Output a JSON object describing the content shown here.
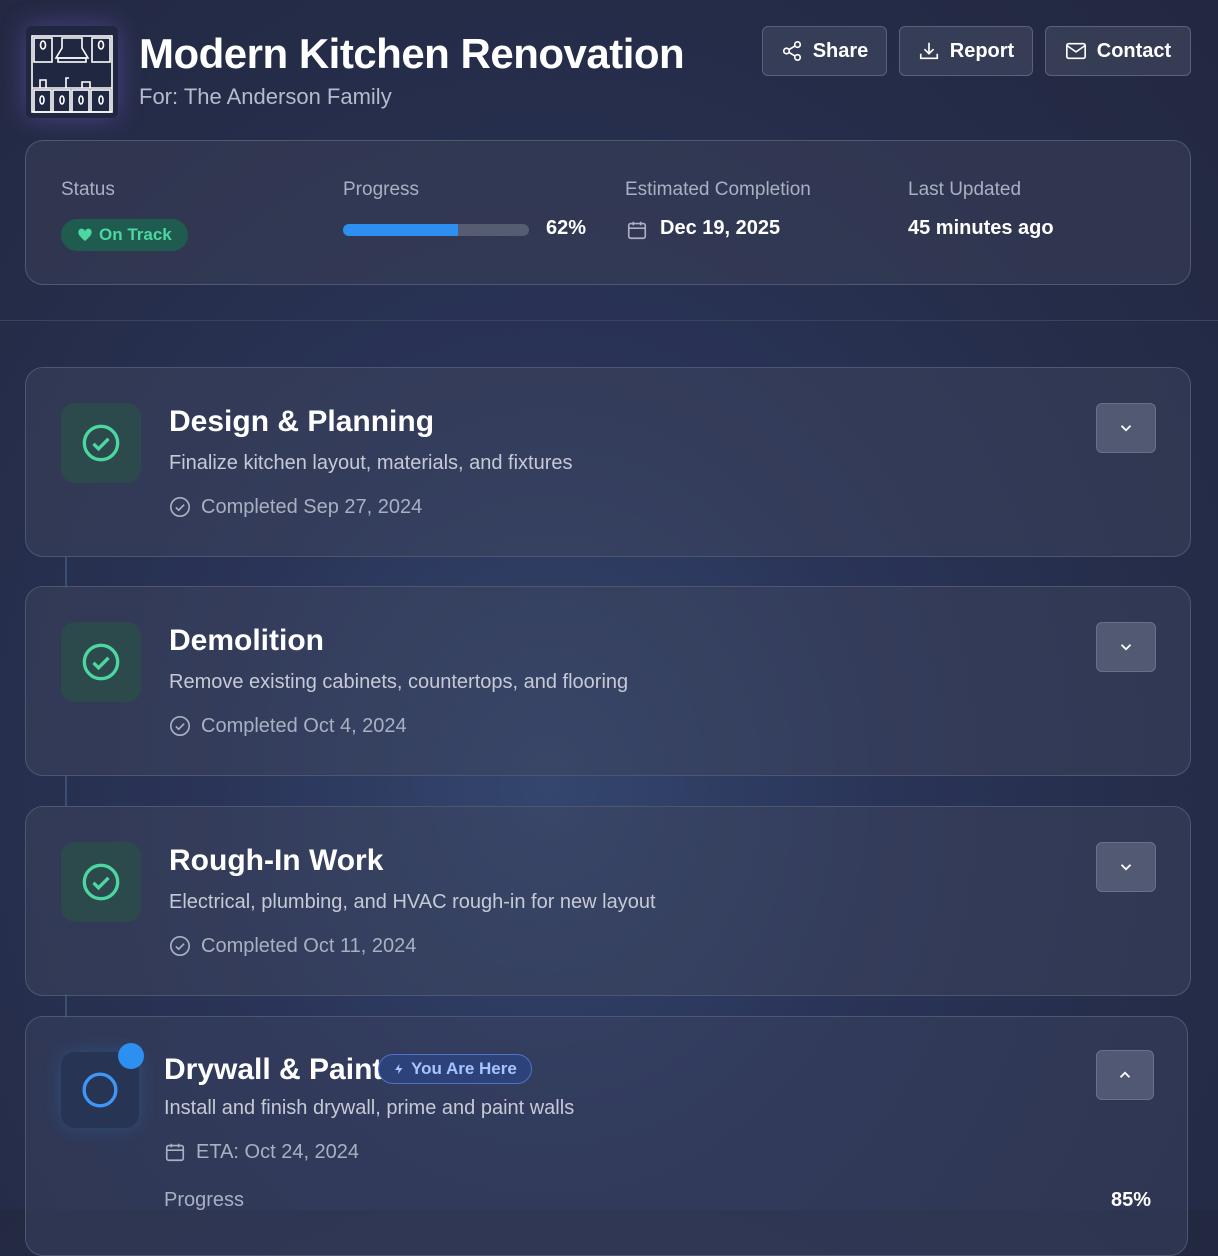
{
  "header": {
    "title": "Modern Kitchen Renovation",
    "subtitle": "For: The Anderson Family",
    "logo_icon": "kitchen-cabinets-icon",
    "buttons": [
      {
        "label": "Share",
        "icon": "share-icon"
      },
      {
        "label": "Report",
        "icon": "download-icon"
      },
      {
        "label": "Contact",
        "icon": "mail-icon"
      }
    ]
  },
  "summary": {
    "status_label": "Status",
    "status_value": "On Track",
    "status_color": "#4cd6a2",
    "progress_label": "Progress",
    "progress_percent": 62,
    "progress_text": "62%",
    "completion_label": "Estimated Completion",
    "completion_value": "Dec 19, 2025",
    "updated_label": "Last Updated",
    "updated_value": "45 minutes ago"
  },
  "phases": [
    {
      "title": "Design & Planning",
      "description": "Finalize kitchen layout, materials, and fixtures",
      "date_text": "Completed Sep 27, 2024",
      "state": "completed"
    },
    {
      "title": "Demolition",
      "description": "Remove existing cabinets, countertops, and flooring",
      "date_text": "Completed Oct 4, 2024",
      "state": "completed"
    },
    {
      "title": "Rough-In Work",
      "description": "Electrical, plumbing, and HVAC rough-in for new layout",
      "date_text": "Completed Oct 11, 2024",
      "state": "completed"
    },
    {
      "title": "Drywall & Paint",
      "description": "Install and finish drywall, prime and paint walls",
      "date_text": "ETA: Oct 24, 2024",
      "state": "current",
      "badge": "You Are Here",
      "progress_label": "Progress",
      "progress_text": "85%"
    }
  ],
  "colors": {
    "accent_blue": "#2d8ff0",
    "success_green": "#4cd6a2"
  }
}
